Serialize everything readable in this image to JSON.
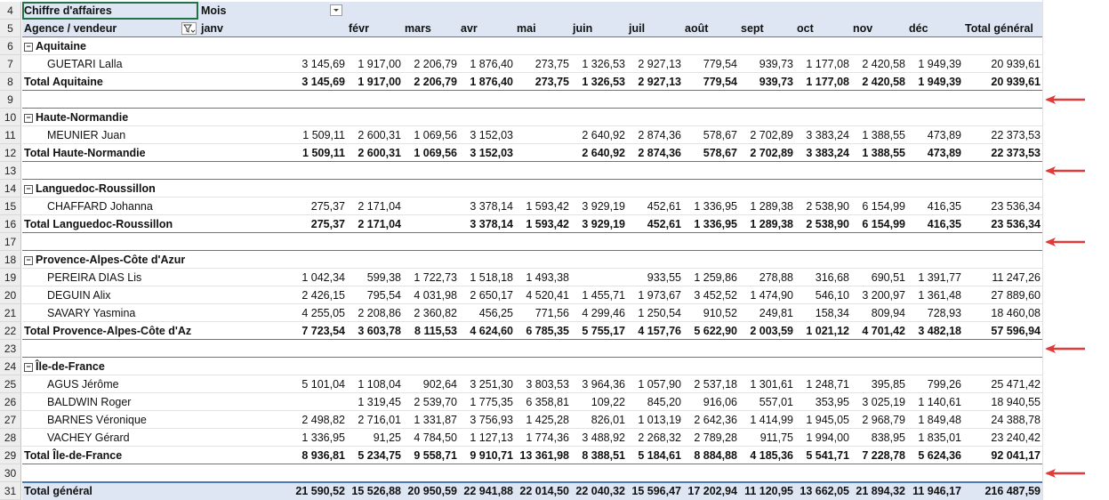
{
  "header_row1": {
    "rownum": "4",
    "title": "Chiffre d'affaires",
    "mois": "Mois"
  },
  "header_row2": {
    "rownum": "5",
    "label": "Agence / vendeur",
    "months": [
      "janv",
      "févr",
      "mars",
      "avr",
      "mai",
      "juin",
      "juil",
      "août",
      "sept",
      "oct",
      "nov",
      "déc",
      "Total général"
    ]
  },
  "rows": [
    {
      "n": "6",
      "type": "group",
      "label": "Aquitaine"
    },
    {
      "n": "7",
      "type": "item",
      "label": "GUETARI Lalla",
      "v": [
        "3 145,69",
        "1 917,00",
        "2 206,79",
        "1 876,40",
        "273,75",
        "1 326,53",
        "2 927,13",
        "779,54",
        "939,73",
        "1 177,08",
        "2 420,58",
        "1 949,39",
        "20 939,61"
      ]
    },
    {
      "n": "8",
      "type": "total",
      "label": "Total Aquitaine",
      "v": [
        "3 145,69",
        "1 917,00",
        "2 206,79",
        "1 876,40",
        "273,75",
        "1 326,53",
        "2 927,13",
        "779,54",
        "939,73",
        "1 177,08",
        "2 420,58",
        "1 949,39",
        "20 939,61"
      ]
    },
    {
      "n": "9",
      "type": "blank",
      "arrow": true
    },
    {
      "n": "10",
      "type": "group",
      "label": "Haute-Normandie"
    },
    {
      "n": "11",
      "type": "item",
      "label": "MEUNIER Juan",
      "v": [
        "1 509,11",
        "2 600,31",
        "1 069,56",
        "3 152,03",
        "",
        "2 640,92",
        "2 874,36",
        "578,67",
        "2 702,89",
        "3 383,24",
        "1 388,55",
        "473,89",
        "22 373,53"
      ]
    },
    {
      "n": "12",
      "type": "total",
      "label": "Total Haute-Normandie",
      "v": [
        "1 509,11",
        "2 600,31",
        "1 069,56",
        "3 152,03",
        "",
        "2 640,92",
        "2 874,36",
        "578,67",
        "2 702,89",
        "3 383,24",
        "1 388,55",
        "473,89",
        "22 373,53"
      ]
    },
    {
      "n": "13",
      "type": "blank",
      "arrow": true
    },
    {
      "n": "14",
      "type": "group",
      "label": "Languedoc-Roussillon"
    },
    {
      "n": "15",
      "type": "item",
      "label": "CHAFFARD Johanna",
      "v": [
        "275,37",
        "2 171,04",
        "",
        "3 378,14",
        "1 593,42",
        "3 929,19",
        "452,61",
        "1 336,95",
        "1 289,38",
        "2 538,90",
        "6 154,99",
        "416,35",
        "23 536,34"
      ]
    },
    {
      "n": "16",
      "type": "total",
      "label": "Total Languedoc-Roussillon",
      "v": [
        "275,37",
        "2 171,04",
        "",
        "3 378,14",
        "1 593,42",
        "3 929,19",
        "452,61",
        "1 336,95",
        "1 289,38",
        "2 538,90",
        "6 154,99",
        "416,35",
        "23 536,34"
      ]
    },
    {
      "n": "17",
      "type": "blank",
      "arrow": true
    },
    {
      "n": "18",
      "type": "group",
      "label": "Provence-Alpes-Côte d'Azur"
    },
    {
      "n": "19",
      "type": "item",
      "label": "PEREIRA DIAS Lis",
      "v": [
        "1 042,34",
        "599,38",
        "1 722,73",
        "1 518,18",
        "1 493,38",
        "",
        "933,55",
        "1 259,86",
        "278,88",
        "316,68",
        "690,51",
        "1 391,77",
        "11 247,26"
      ]
    },
    {
      "n": "20",
      "type": "item",
      "label": "DEGUIN Alix",
      "v": [
        "2 426,15",
        "795,54",
        "4 031,98",
        "2 650,17",
        "4 520,41",
        "1 455,71",
        "1 973,67",
        "3 452,52",
        "1 474,90",
        "546,10",
        "3 200,97",
        "1 361,48",
        "27 889,60"
      ]
    },
    {
      "n": "21",
      "type": "item",
      "label": "SAVARY Yasmina",
      "v": [
        "4 255,05",
        "2 208,86",
        "2 360,82",
        "456,25",
        "771,56",
        "4 299,46",
        "1 250,54",
        "910,52",
        "249,81",
        "158,34",
        "809,94",
        "728,93",
        "18 460,08"
      ]
    },
    {
      "n": "22",
      "type": "total",
      "label": "Total Provence-Alpes-Côte d'Az",
      "v": [
        "7 723,54",
        "3 603,78",
        "8 115,53",
        "4 624,60",
        "6 785,35",
        "5 755,17",
        "4 157,76",
        "5 622,90",
        "2 003,59",
        "1 021,12",
        "4 701,42",
        "3 482,18",
        "57 596,94"
      ]
    },
    {
      "n": "23",
      "type": "blank",
      "arrow": true
    },
    {
      "n": "24",
      "type": "group",
      "label": "Île-de-France"
    },
    {
      "n": "25",
      "type": "item",
      "label": "AGUS Jérôme",
      "v": [
        "5 101,04",
        "1 108,04",
        "902,64",
        "3 251,30",
        "3 803,53",
        "3 964,36",
        "1 057,90",
        "2 537,18",
        "1 301,61",
        "1 248,71",
        "395,85",
        "799,26",
        "25 471,42"
      ]
    },
    {
      "n": "26",
      "type": "item",
      "label": "BALDWIN Roger",
      "v": [
        "",
        "1 319,45",
        "2 539,70",
        "1 775,35",
        "6 358,81",
        "109,22",
        "845,20",
        "916,06",
        "557,01",
        "353,95",
        "3 025,19",
        "1 140,61",
        "18 940,55"
      ]
    },
    {
      "n": "27",
      "type": "item",
      "label": "BARNES Véronique",
      "v": [
        "2 498,82",
        "2 716,01",
        "1 331,87",
        "3 756,93",
        "1 425,28",
        "826,01",
        "1 013,19",
        "2 642,36",
        "1 414,99",
        "1 945,05",
        "2 968,79",
        "1 849,48",
        "24 388,78"
      ]
    },
    {
      "n": "28",
      "type": "item",
      "label": "VACHEY Gérard",
      "v": [
        "1 336,95",
        "91,25",
        "4 784,50",
        "1 127,13",
        "1 774,36",
        "3 488,92",
        "2 268,32",
        "2 789,28",
        "911,75",
        "1 994,00",
        "838,95",
        "1 835,01",
        "23 240,42"
      ]
    },
    {
      "n": "29",
      "type": "total",
      "label": "Total Île-de-France",
      "v": [
        "8 936,81",
        "5 234,75",
        "9 558,71",
        "9 910,71",
        "13 361,98",
        "8 388,51",
        "5 184,61",
        "8 884,88",
        "4 185,36",
        "5 541,71",
        "7 228,78",
        "5 624,36",
        "92 041,17"
      ]
    },
    {
      "n": "30",
      "type": "blank",
      "arrow": true
    },
    {
      "n": "31",
      "type": "grand",
      "label": "Total général",
      "v": [
        "21 590,52",
        "15 526,88",
        "20 950,59",
        "22 941,88",
        "22 014,50",
        "22 040,32",
        "15 596,47",
        "17 202,94",
        "11 120,95",
        "13 662,05",
        "21 894,32",
        "11 946,17",
        "216 487,59"
      ]
    }
  ],
  "colors": {
    "header_bg": "#dde6f2",
    "total_line": "#4a7ab7",
    "arrow": "#e03a3a",
    "rownum_bg": "#ededed"
  }
}
